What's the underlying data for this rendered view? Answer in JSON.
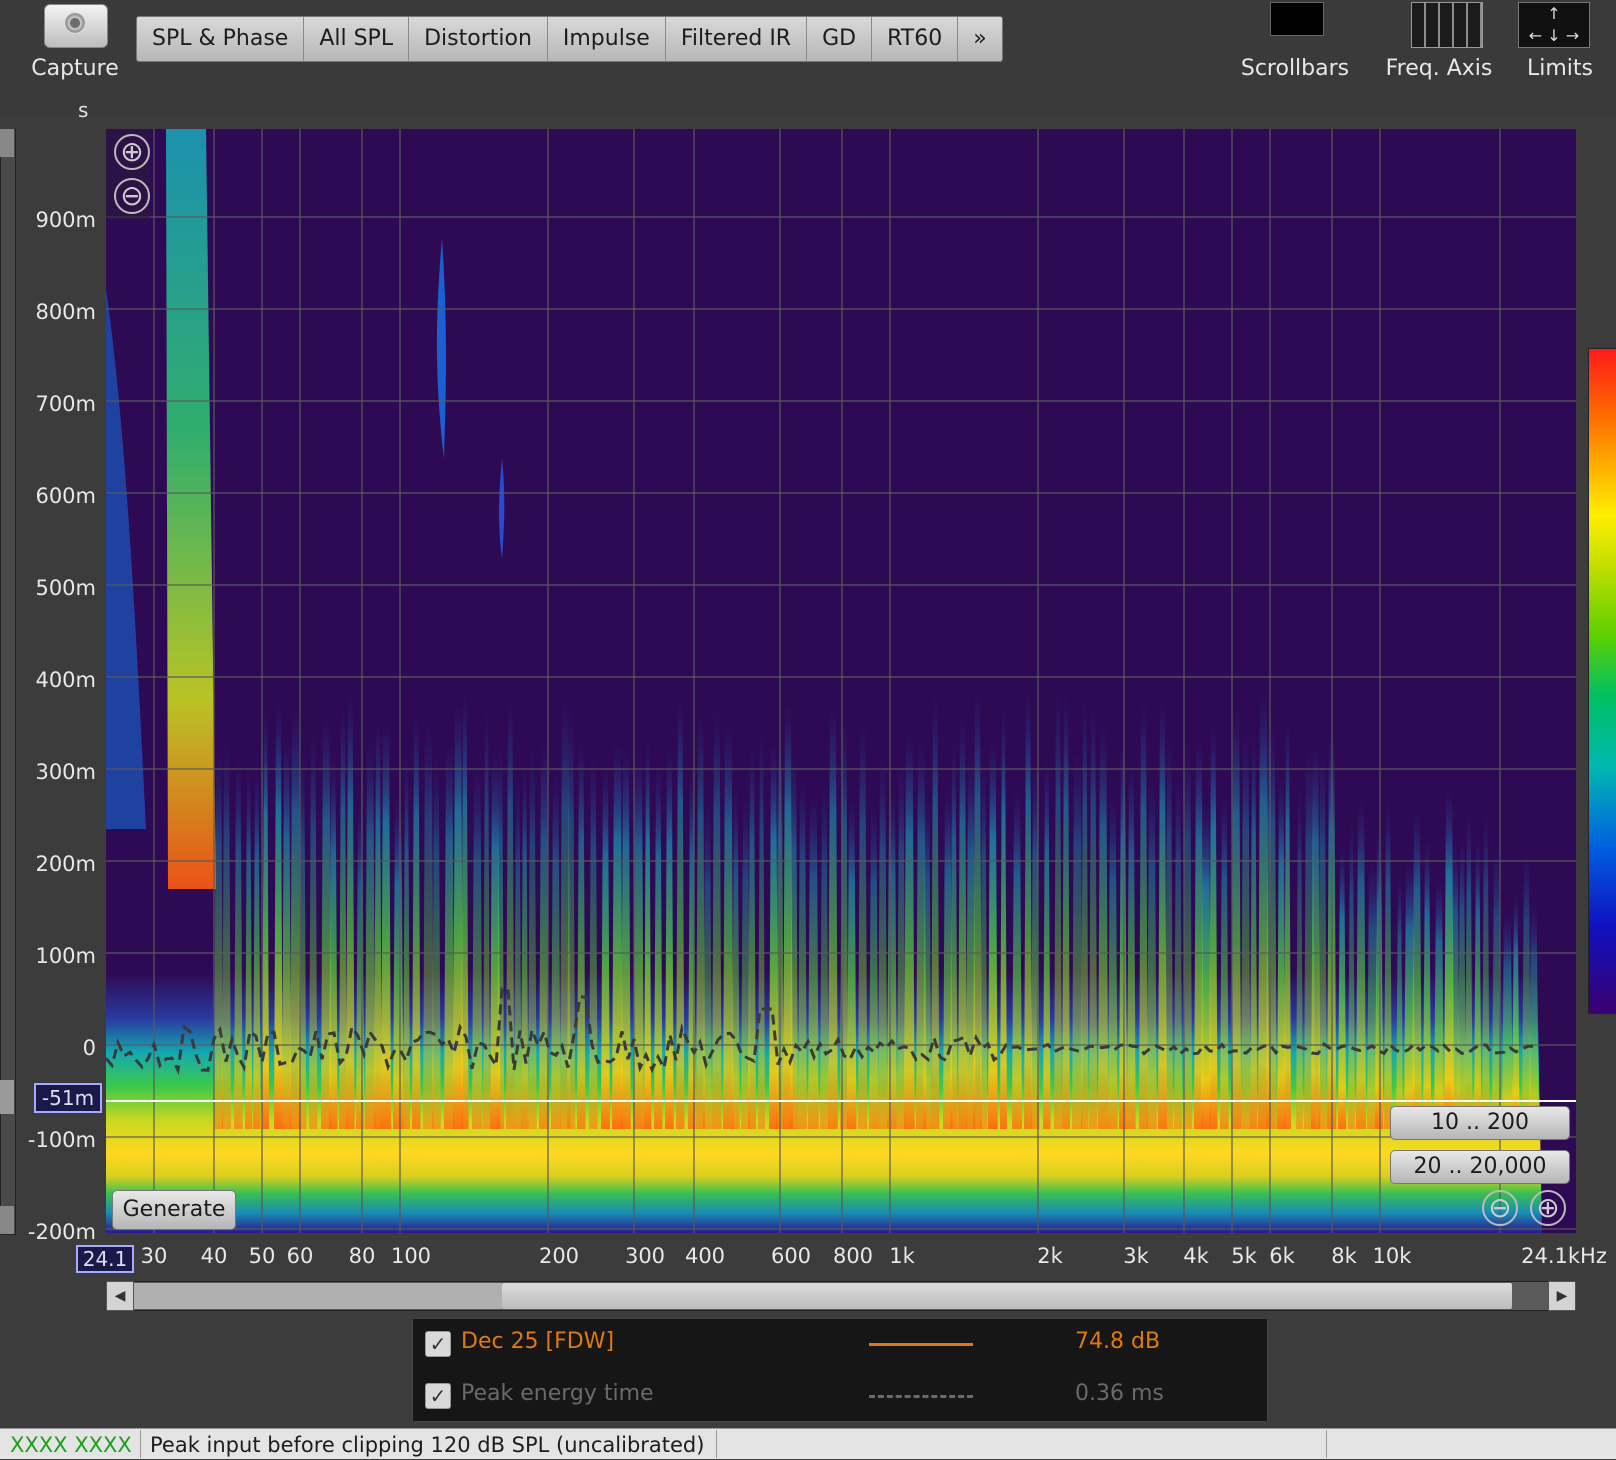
{
  "toolbar": {
    "capture_label": "Capture",
    "tabs": [
      "SPL & Phase",
      "All SPL",
      "Distortion",
      "Impulse",
      "Filtered IR",
      "GD",
      "RT60",
      "»"
    ],
    "scrollbars_label": "Scrollbars",
    "freq_axis_label": "Freq. Axis",
    "limits_label": "Limits"
  },
  "plot": {
    "y_unit": "s",
    "y_ticks": [
      "900m",
      "800m",
      "700m",
      "600m",
      "500m",
      "400m",
      "300m",
      "200m",
      "100m",
      "0",
      "-100m",
      "-200m"
    ],
    "x_ticks": [
      "30",
      "40",
      "50",
      "60",
      "80",
      "100",
      "200",
      "300",
      "400",
      "600",
      "800",
      "1k",
      "2k",
      "3k",
      "4k",
      "5k",
      "6k",
      "8k",
      "10k",
      "24.1kHz"
    ],
    "cursor_y": "-51m",
    "cursor_x": "24.1",
    "zoom_in_symbol": "⊕",
    "zoom_out_symbol": "⊖"
  },
  "buttons": {
    "generate": "Generate",
    "range1": "10 .. 200",
    "range2": "20 .. 20,000"
  },
  "legend": {
    "row1": {
      "name": "Dec 25 [FDW]",
      "value": "74.8 dB",
      "color": "#e07a10"
    },
    "row2": {
      "name": "Peak energy time",
      "value": "0.36 ms",
      "color": "#6a6a6a"
    }
  },
  "status": {
    "left": "XXXX XXXX",
    "text": "Peak input before clipping 120 dB SPL (uncalibrated)"
  },
  "colors": {
    "plot_background": "#2e0a55",
    "accent": "#a9a9ff"
  }
}
